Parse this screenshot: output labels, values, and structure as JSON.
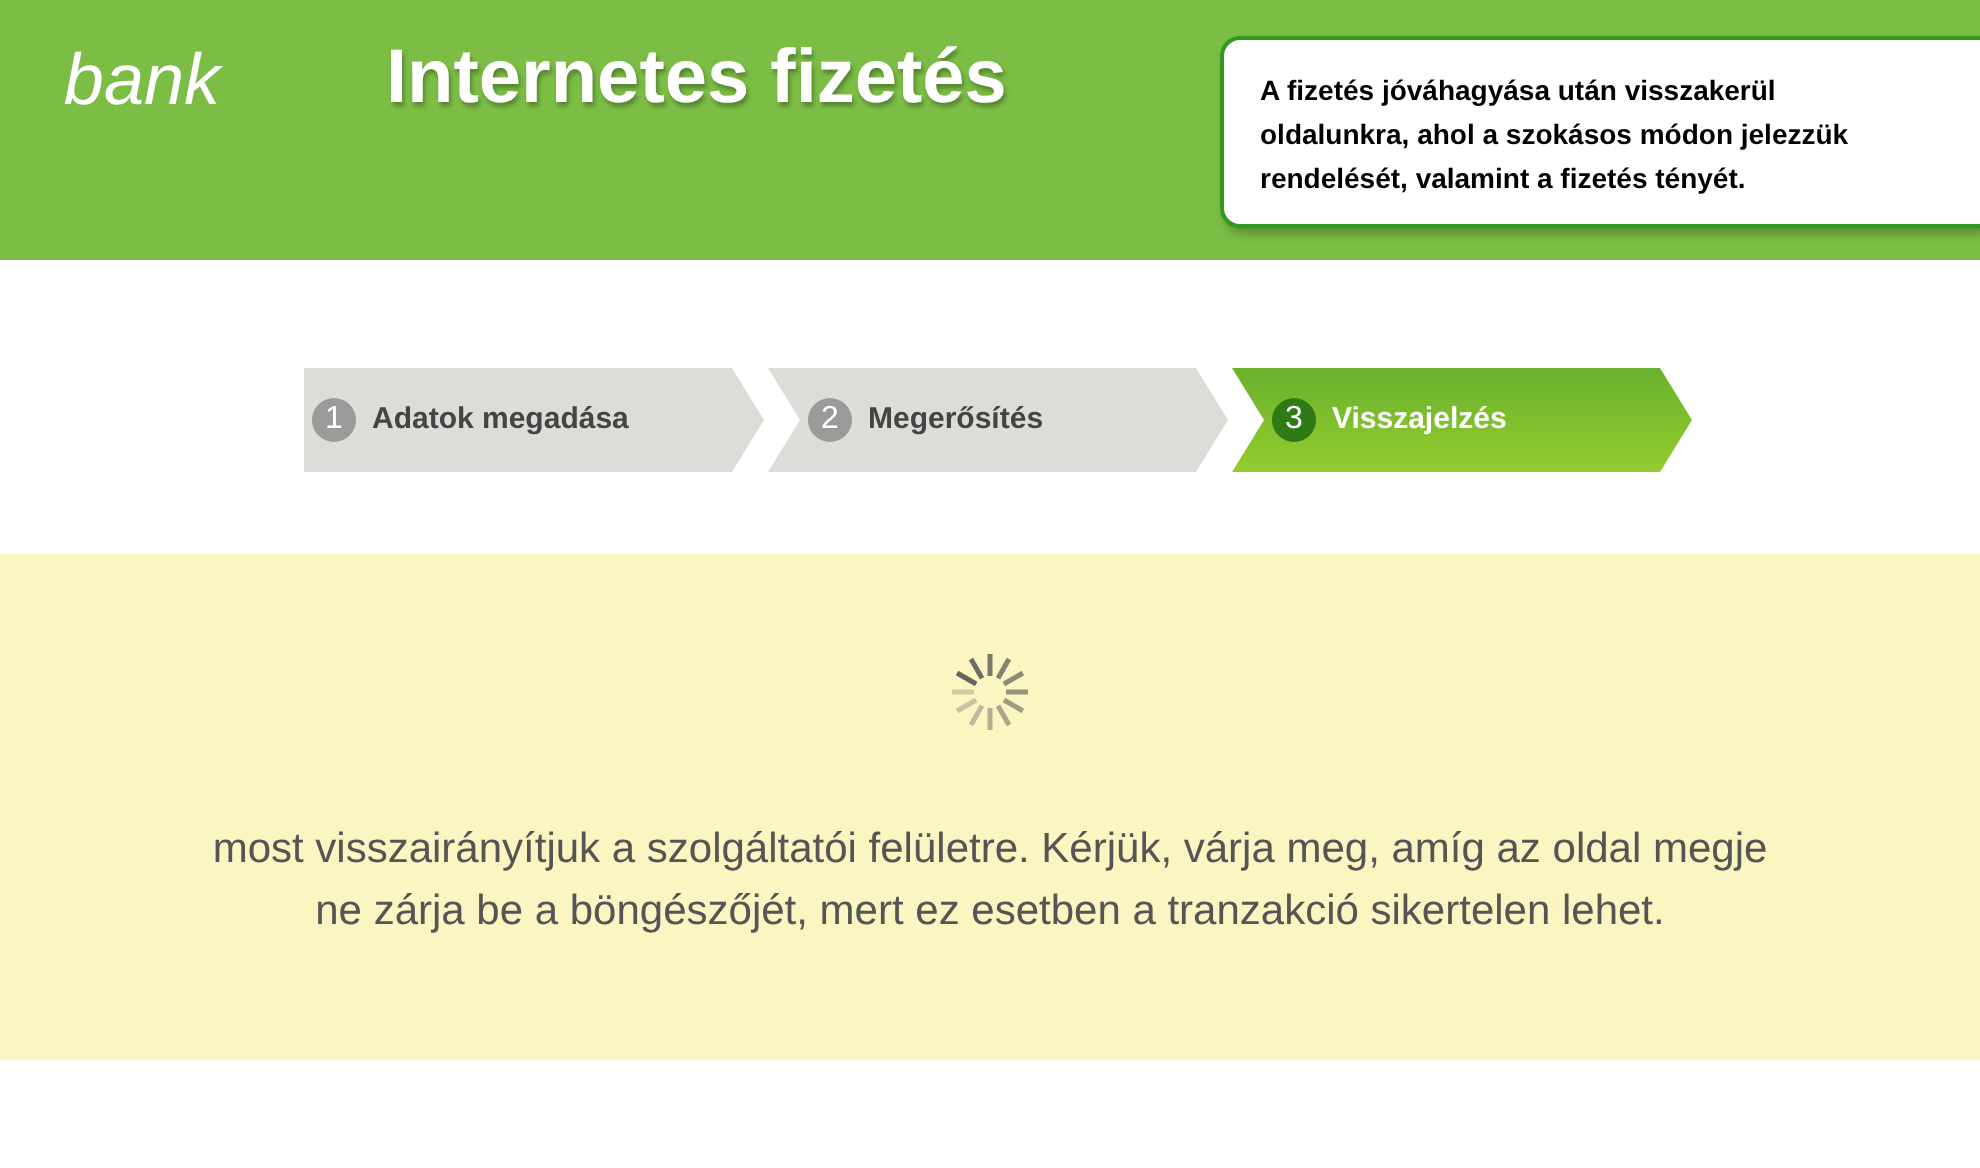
{
  "header": {
    "logo": "bank",
    "title": "Internetes fizetés",
    "notice": "A fizetés jóváhagyása után visszakerül oldalunkra, ahol a szokásos módon jelezzük rendelését, valamint a fizetés tényét."
  },
  "steps": [
    {
      "number": "1",
      "label": "Adatok megadása",
      "selected": false
    },
    {
      "number": "2",
      "label": "Megerősítés",
      "selected": false
    },
    {
      "number": "3",
      "label": "Visszajelzés",
      "selected": true
    }
  ],
  "message": {
    "lines": [
      "most visszairányítjuk a szolgáltatói felületre. Kérjük, várja meg, amíg az oldal megje",
      "ne zárja be a böngészőjét, mert ez esetben a tranzakció sikertelen lehet."
    ]
  }
}
